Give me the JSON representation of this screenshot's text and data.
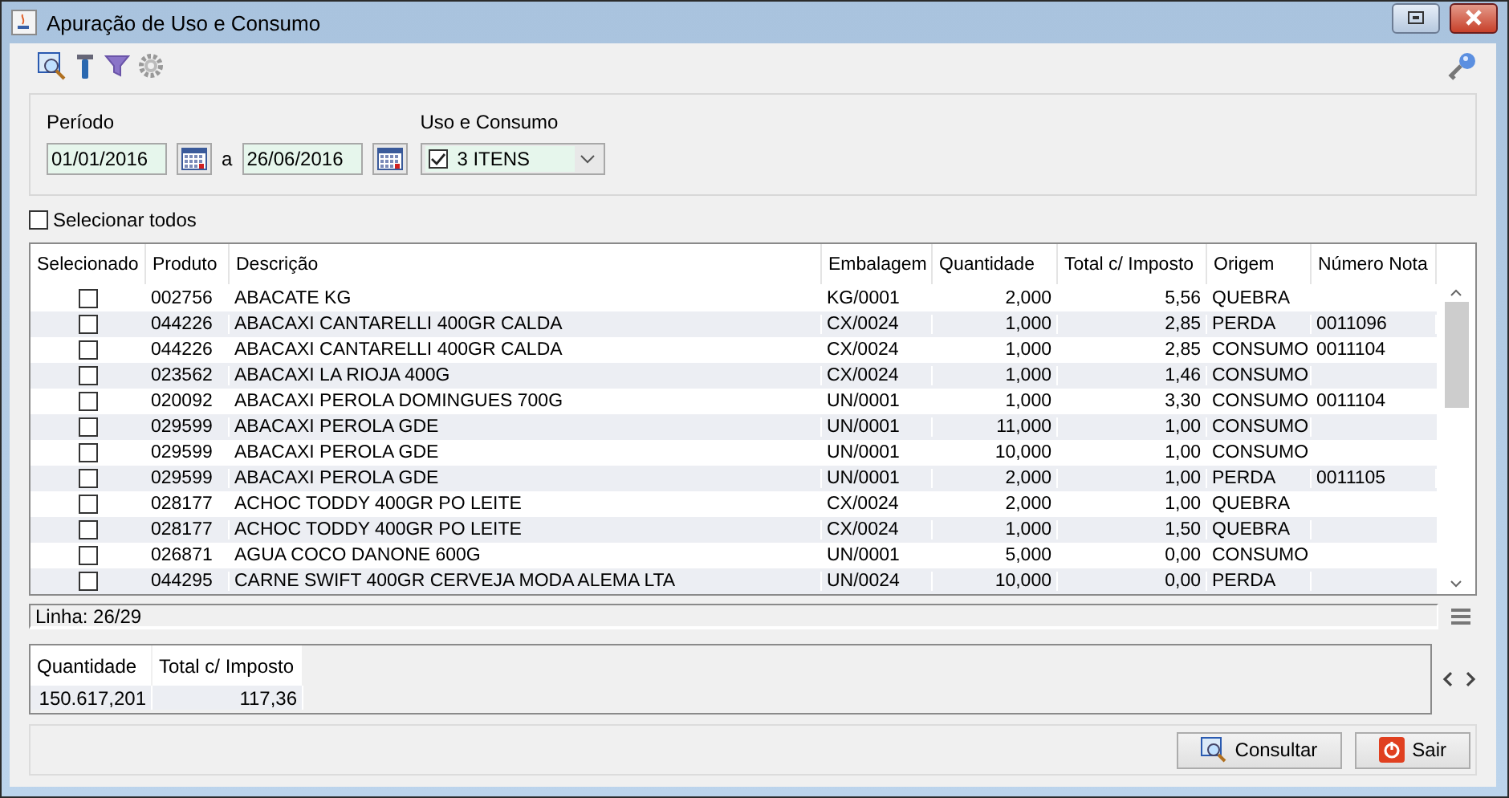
{
  "window": {
    "title": "Apuração de Uso e Consumo"
  },
  "filters": {
    "period_label": "Período",
    "date_from": "01/01/2016",
    "separator": "a",
    "date_to": "26/06/2016",
    "usage_label": "Uso e Consumo",
    "usage_value": "3 ITENS",
    "usage_checked": true
  },
  "select_all": {
    "label": "Selecionar todos",
    "checked": false
  },
  "table": {
    "columns": [
      "Selecionado",
      "Produto",
      "Descrição",
      "Embalagem",
      "Quantidade",
      "Total c/ Imposto",
      "Origem",
      "Número Nota"
    ],
    "rows": [
      {
        "checked": false,
        "cells": [
          "",
          "002756",
          "ABACATE KG",
          "KG/0001",
          "2,000",
          "5,56",
          "QUEBRA",
          ""
        ]
      },
      {
        "checked": false,
        "cells": [
          "",
          "044226",
          "ABACAXI CANTARELLI 400GR CALDA",
          "CX/0024",
          "1,000",
          "2,85",
          "PERDA",
          "0011096"
        ]
      },
      {
        "checked": false,
        "cells": [
          "",
          "044226",
          "ABACAXI CANTARELLI 400GR CALDA",
          "CX/0024",
          "1,000",
          "2,85",
          "CONSUMO",
          "0011104"
        ]
      },
      {
        "checked": false,
        "cells": [
          "",
          "023562",
          "ABACAXI LA RIOJA 400G",
          "CX/0024",
          "1,000",
          "1,46",
          "CONSUMO",
          ""
        ]
      },
      {
        "checked": false,
        "cells": [
          "",
          "020092",
          "ABACAXI PEROLA DOMINGUES 700G",
          "UN/0001",
          "1,000",
          "3,30",
          "CONSUMO",
          "0011104"
        ]
      },
      {
        "checked": false,
        "cells": [
          "",
          "029599",
          "ABACAXI PEROLA GDE",
          "UN/0001",
          "11,000",
          "1,00",
          "CONSUMO",
          ""
        ]
      },
      {
        "checked": false,
        "cells": [
          "",
          "029599",
          "ABACAXI PEROLA GDE",
          "UN/0001",
          "10,000",
          "1,00",
          "CONSUMO",
          ""
        ]
      },
      {
        "checked": false,
        "cells": [
          "",
          "029599",
          "ABACAXI PEROLA GDE",
          "UN/0001",
          "2,000",
          "1,00",
          "PERDA",
          "0011105"
        ]
      },
      {
        "checked": false,
        "cells": [
          "",
          "028177",
          "ACHOC TODDY 400GR PO LEITE",
          "CX/0024",
          "2,000",
          "1,00",
          "QUEBRA",
          ""
        ]
      },
      {
        "checked": false,
        "cells": [
          "",
          "028177",
          "ACHOC TODDY 400GR PO LEITE",
          "CX/0024",
          "1,000",
          "1,50",
          "QUEBRA",
          ""
        ]
      },
      {
        "checked": false,
        "cells": [
          "",
          "026871",
          "AGUA COCO DANONE 600G",
          "UN/0001",
          "5,000",
          "0,00",
          "CONSUMO",
          ""
        ]
      },
      {
        "checked": false,
        "cells": [
          "",
          "044295",
          "CARNE SWIFT 400GR CERVEJA MODA ALEMA LTA",
          "UN/0024",
          "10,000",
          "0,00",
          "PERDA",
          ""
        ]
      }
    ]
  },
  "status": {
    "text": "Linha: 26/29"
  },
  "totals": {
    "columns": [
      "Quantidade",
      "Total c/ Imposto"
    ],
    "values": [
      "150.617,201",
      "117,36"
    ]
  },
  "buttons": [
    {
      "kind": "search",
      "label": "Consultar"
    },
    {
      "kind": "exit",
      "label": "Sair"
    }
  ]
}
